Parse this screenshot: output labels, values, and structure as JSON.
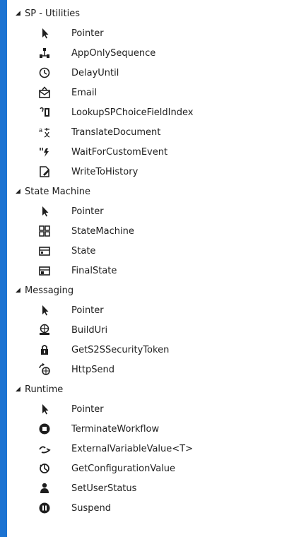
{
  "colors": {
    "window_border": "#1c73d2",
    "panel_bg": "#ffffff",
    "text": "#1e1e1e",
    "icon": "#1e1e1e"
  },
  "groups": [
    {
      "label": "SP - Utilities",
      "expanded": true,
      "items": [
        {
          "label": "Pointer",
          "icon": "pointer-icon"
        },
        {
          "label": "AppOnlySequence",
          "icon": "sequence-icon"
        },
        {
          "label": "DelayUntil",
          "icon": "clock-icon"
        },
        {
          "label": "Email",
          "icon": "email-icon"
        },
        {
          "label": "LookupSPChoiceFieldIndex",
          "icon": "lookup-icon"
        },
        {
          "label": "TranslateDocument",
          "icon": "translate-icon"
        },
        {
          "label": "WaitForCustomEvent",
          "icon": "event-icon"
        },
        {
          "label": "WriteToHistory",
          "icon": "write-icon"
        }
      ]
    },
    {
      "label": "State Machine",
      "expanded": true,
      "items": [
        {
          "label": "Pointer",
          "icon": "pointer-icon"
        },
        {
          "label": "StateMachine",
          "icon": "state-machine-icon"
        },
        {
          "label": "State",
          "icon": "state-icon"
        },
        {
          "label": "FinalState",
          "icon": "final-state-icon"
        }
      ]
    },
    {
      "label": "Messaging",
      "expanded": true,
      "items": [
        {
          "label": "Pointer",
          "icon": "pointer-icon"
        },
        {
          "label": "BuildUri",
          "icon": "build-uri-icon"
        },
        {
          "label": "GetS2SSecurityToken",
          "icon": "lock-icon"
        },
        {
          "label": "HttpSend",
          "icon": "http-send-icon"
        }
      ]
    },
    {
      "label": "Runtime",
      "expanded": true,
      "items": [
        {
          "label": "Pointer",
          "icon": "pointer-icon"
        },
        {
          "label": "TerminateWorkflow",
          "icon": "terminate-icon"
        },
        {
          "label": "ExternalVariableValue<T>",
          "icon": "external-variable-icon"
        },
        {
          "label": "GetConfigurationValue",
          "icon": "configuration-icon"
        },
        {
          "label": "SetUserStatus",
          "icon": "user-status-icon"
        },
        {
          "label": "Suspend",
          "icon": "suspend-icon"
        }
      ]
    }
  ]
}
